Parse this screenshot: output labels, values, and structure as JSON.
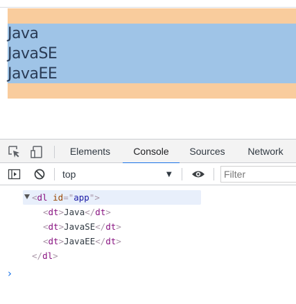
{
  "page": {
    "dl_items": [
      "Java",
      "JavaSE",
      "JavaEE"
    ]
  },
  "devtools": {
    "tabs": [
      {
        "label": "Elements",
        "active": false
      },
      {
        "label": "Console",
        "active": true
      },
      {
        "label": "Sources",
        "active": false
      },
      {
        "label": "Network",
        "active": false
      }
    ],
    "toolbar": {
      "context": "top",
      "filter_placeholder": "Filter"
    },
    "console_output": {
      "dl_open": {
        "tag": "dl",
        "attr_name": "id",
        "attr_value": "app"
      },
      "children": [
        {
          "tag": "dt",
          "text": "Java"
        },
        {
          "tag": "dt",
          "text": "JavaSE"
        },
        {
          "tag": "dt",
          "text": "JavaEE"
        }
      ],
      "dl_close": "dl",
      "prompt": "›"
    }
  },
  "colors": {
    "margin_highlight": "#f9cc9d",
    "content_highlight": "#9fc4e7",
    "active_tab_underline": "#1a73e8"
  },
  "icons": [
    "inspect-element-icon",
    "device-toolbar-icon",
    "sidebar-toggle-icon",
    "clear-console-icon",
    "chevron-down-icon",
    "eye-icon"
  ]
}
